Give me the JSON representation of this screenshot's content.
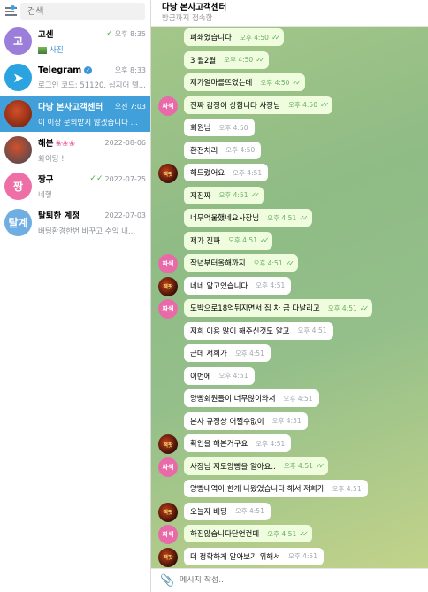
{
  "sidebar": {
    "search_placeholder": "검색",
    "chats": [
      {
        "avatar_text": "고",
        "avatar_color": "#9b7ed9",
        "name": "고센",
        "time": "오후 8:35",
        "check": "✓",
        "preview": "사진",
        "preview_color": "blue",
        "active": false
      },
      {
        "avatar_text": "",
        "avatar_color": "#2aa3e0",
        "name": "Telegram",
        "time": "오후 8:33",
        "check": "",
        "preview": "로그인 코드: 51120. 심지어 텔...",
        "verified": true,
        "active": false
      },
      {
        "avatar_text": "",
        "avatar_color": "#8a2a12",
        "name": "다낭 본사고객센터",
        "time": "오전 7:03",
        "check": "",
        "preview": "이 이상 문의받지 않겠습니다 ...",
        "active": true
      },
      {
        "avatar_text": "",
        "avatar_color": "#6a4a4a",
        "name": "해븐",
        "flowers": "❀❀❀",
        "time": "2022-08-06",
        "check": "",
        "preview": "화이팅 !",
        "active": false
      },
      {
        "avatar_text": "짱",
        "avatar_color": "#ee6fa6",
        "name": "짱구",
        "time": "2022-07-25",
        "check": "✓✓",
        "preview": "네헿",
        "active": false
      },
      {
        "avatar_text": "탈계",
        "avatar_color": "#6faee3",
        "name": "탈퇴한 계정",
        "time": "2022-07-03",
        "check": "",
        "preview": "배팅환경한번 바꾸고 수익 내...",
        "active": false
      }
    ]
  },
  "chat": {
    "title": "다낭 본사고객센터",
    "status": "방금까지 접속함",
    "input_placeholder": "메시지 작성...",
    "messages": [
      {
        "text": "폐쇄였습니다",
        "time": "오후 4:50",
        "ticks": "✓✓",
        "out": true,
        "avatar": ""
      },
      {
        "text": "3 월2월",
        "time": "오후 4:50",
        "ticks": "✓✓",
        "out": true,
        "avatar": ""
      },
      {
        "text": "제가열마를뜨였는데",
        "time": "오후 4:50",
        "ticks": "✓✓",
        "out": true,
        "avatar": ""
      },
      {
        "text": "진짜 감정이 상합니다 사장님",
        "time": "오후 4:50",
        "ticks": "✓✓",
        "out": true,
        "avatar": "pink",
        "avatar_text": "짜색"
      },
      {
        "text": "회원님",
        "time": "오후 4:50",
        "ticks": "",
        "out": false,
        "avatar": ""
      },
      {
        "text": "환전처리",
        "time": "오후 4:50",
        "ticks": "",
        "out": false,
        "avatar": ""
      },
      {
        "text": "해드렸어요",
        "time": "오후 4:51",
        "ticks": "",
        "out": false,
        "avatar": "dark",
        "avatar_text": "잭팟"
      },
      {
        "text": "저진짜",
        "time": "오후 4:51",
        "ticks": "✓✓",
        "out": true,
        "avatar": ""
      },
      {
        "text": "너무억울했네요사장님",
        "time": "오후 4:51",
        "ticks": "✓✓",
        "out": true,
        "avatar": ""
      },
      {
        "text": "제가 진짜",
        "time": "오후 4:51",
        "ticks": "✓✓",
        "out": true,
        "avatar": ""
      },
      {
        "text": "작년부터올해까지",
        "time": "오후 4:51",
        "ticks": "✓✓",
        "out": true,
        "avatar": "pink",
        "avatar_text": "짜색"
      },
      {
        "text": "네네 알고있습니다",
        "time": "오후 4:51",
        "ticks": "",
        "out": false,
        "avatar": "dark",
        "avatar_text": "잭팟"
      },
      {
        "text": "도박으로18억뒤지면서 집 차 금 다날리고",
        "time": "오후 4:51",
        "ticks": "✓✓",
        "out": true,
        "avatar": "pink",
        "avatar_text": "짜색"
      },
      {
        "text": "저희 이용 많이 해주신것도 알고",
        "time": "오후 4:51",
        "ticks": "",
        "out": false,
        "avatar": ""
      },
      {
        "text": "근데 저희가",
        "time": "오후 4:51",
        "ticks": "",
        "out": false,
        "avatar": ""
      },
      {
        "text": "이번에",
        "time": "오후 4:51",
        "ticks": "",
        "out": false,
        "avatar": ""
      },
      {
        "text": "양빵회원들이 너무많이와서",
        "time": "오후 4:51",
        "ticks": "",
        "out": false,
        "avatar": ""
      },
      {
        "text": "본사 규정상 어쩔수없이",
        "time": "오후 4:51",
        "ticks": "",
        "out": false,
        "avatar": ""
      },
      {
        "text": "확인을 해본거구요",
        "time": "오후 4:51",
        "ticks": "",
        "out": false,
        "avatar": "dark",
        "avatar_text": "잭팟"
      },
      {
        "text": "사장님 저도양빵을 알아요..",
        "time": "오후 4:51",
        "ticks": "✓✓",
        "out": true,
        "avatar": "pink",
        "avatar_text": "짜색"
      },
      {
        "text": "양빵내역이 한개 나왔었습니다 해서 저희가",
        "time": "오후 4:51",
        "ticks": "",
        "out": false,
        "avatar": ""
      },
      {
        "text": "오늘자 배팅",
        "time": "오후 4:51",
        "ticks": "",
        "out": false,
        "avatar": "dark",
        "avatar_text": "잭팟"
      },
      {
        "text": "하진않습니다단언컨데",
        "time": "오후 4:51",
        "ticks": "✓✓",
        "out": true,
        "avatar": "pink",
        "avatar_text": "짜색"
      },
      {
        "text": "더 정확하게 알아보기 위해서",
        "time": "오후 4:51",
        "ticks": "",
        "out": false,
        "avatar": "dark",
        "avatar_text": "잭팟"
      }
    ]
  }
}
